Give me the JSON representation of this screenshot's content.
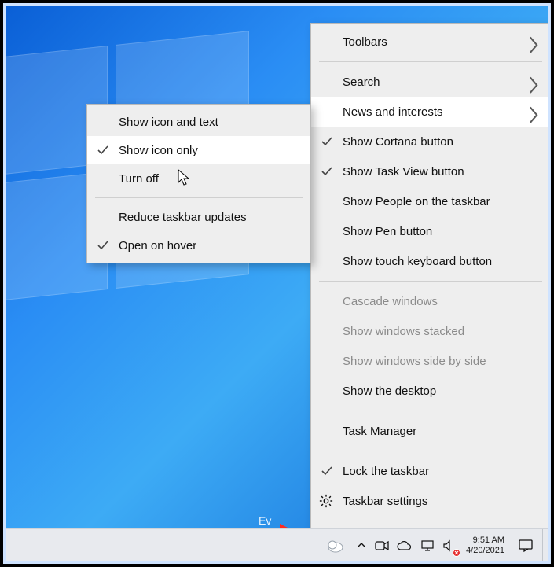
{
  "submenu": {
    "items": [
      {
        "label": "Show icon and text",
        "checked": false
      },
      {
        "label": "Show icon only",
        "checked": true,
        "hovered": true
      },
      {
        "label": "Turn off",
        "checked": false
      }
    ],
    "extra": [
      {
        "label": "Reduce taskbar updates",
        "checked": false
      },
      {
        "label": "Open on hover",
        "checked": true
      }
    ]
  },
  "mainmenu": {
    "group1": [
      {
        "label": "Toolbars",
        "arrow": true
      }
    ],
    "group2": [
      {
        "label": "Search",
        "arrow": true
      },
      {
        "label": "News and interests",
        "arrow": true,
        "hovered": true
      },
      {
        "label": "Show Cortana button",
        "checked": true
      },
      {
        "label": "Show Task View button",
        "checked": true
      },
      {
        "label": "Show People on the taskbar"
      },
      {
        "label": "Show Pen button"
      },
      {
        "label": "Show touch keyboard button"
      }
    ],
    "group3": [
      {
        "label": "Cascade windows",
        "disabled": true
      },
      {
        "label": "Show windows stacked",
        "disabled": true
      },
      {
        "label": "Show windows side by side",
        "disabled": true
      },
      {
        "label": "Show the desktop"
      }
    ],
    "group4": [
      {
        "label": "Task Manager"
      }
    ],
    "group5": [
      {
        "label": "Lock the taskbar",
        "checked": true
      },
      {
        "label": "Taskbar settings",
        "gear": true
      }
    ]
  },
  "tray": {
    "time": "9:51 AM",
    "date": "4/20/2021"
  },
  "desktop": {
    "truncated_label": "Ev"
  }
}
